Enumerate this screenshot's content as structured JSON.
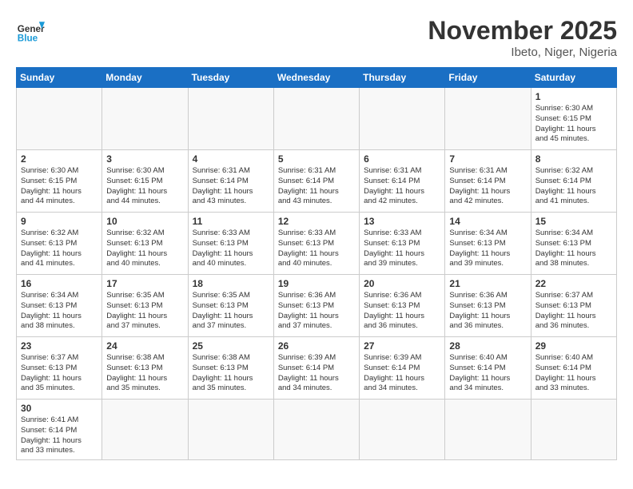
{
  "header": {
    "logo_general": "General",
    "logo_blue": "Blue",
    "month": "November 2025",
    "location": "Ibeto, Niger, Nigeria"
  },
  "days_of_week": [
    "Sunday",
    "Monday",
    "Tuesday",
    "Wednesday",
    "Thursday",
    "Friday",
    "Saturday"
  ],
  "weeks": [
    [
      {
        "day": "",
        "info": ""
      },
      {
        "day": "",
        "info": ""
      },
      {
        "day": "",
        "info": ""
      },
      {
        "day": "",
        "info": ""
      },
      {
        "day": "",
        "info": ""
      },
      {
        "day": "",
        "info": ""
      },
      {
        "day": "1",
        "info": "Sunrise: 6:30 AM\nSunset: 6:15 PM\nDaylight: 11 hours\nand 45 minutes."
      }
    ],
    [
      {
        "day": "2",
        "info": "Sunrise: 6:30 AM\nSunset: 6:15 PM\nDaylight: 11 hours\nand 44 minutes."
      },
      {
        "day": "3",
        "info": "Sunrise: 6:30 AM\nSunset: 6:15 PM\nDaylight: 11 hours\nand 44 minutes."
      },
      {
        "day": "4",
        "info": "Sunrise: 6:31 AM\nSunset: 6:14 PM\nDaylight: 11 hours\nand 43 minutes."
      },
      {
        "day": "5",
        "info": "Sunrise: 6:31 AM\nSunset: 6:14 PM\nDaylight: 11 hours\nand 43 minutes."
      },
      {
        "day": "6",
        "info": "Sunrise: 6:31 AM\nSunset: 6:14 PM\nDaylight: 11 hours\nand 42 minutes."
      },
      {
        "day": "7",
        "info": "Sunrise: 6:31 AM\nSunset: 6:14 PM\nDaylight: 11 hours\nand 42 minutes."
      },
      {
        "day": "8",
        "info": "Sunrise: 6:32 AM\nSunset: 6:14 PM\nDaylight: 11 hours\nand 41 minutes."
      }
    ],
    [
      {
        "day": "9",
        "info": "Sunrise: 6:32 AM\nSunset: 6:13 PM\nDaylight: 11 hours\nand 41 minutes."
      },
      {
        "day": "10",
        "info": "Sunrise: 6:32 AM\nSunset: 6:13 PM\nDaylight: 11 hours\nand 40 minutes."
      },
      {
        "day": "11",
        "info": "Sunrise: 6:33 AM\nSunset: 6:13 PM\nDaylight: 11 hours\nand 40 minutes."
      },
      {
        "day": "12",
        "info": "Sunrise: 6:33 AM\nSunset: 6:13 PM\nDaylight: 11 hours\nand 40 minutes."
      },
      {
        "day": "13",
        "info": "Sunrise: 6:33 AM\nSunset: 6:13 PM\nDaylight: 11 hours\nand 39 minutes."
      },
      {
        "day": "14",
        "info": "Sunrise: 6:34 AM\nSunset: 6:13 PM\nDaylight: 11 hours\nand 39 minutes."
      },
      {
        "day": "15",
        "info": "Sunrise: 6:34 AM\nSunset: 6:13 PM\nDaylight: 11 hours\nand 38 minutes."
      }
    ],
    [
      {
        "day": "16",
        "info": "Sunrise: 6:34 AM\nSunset: 6:13 PM\nDaylight: 11 hours\nand 38 minutes."
      },
      {
        "day": "17",
        "info": "Sunrise: 6:35 AM\nSunset: 6:13 PM\nDaylight: 11 hours\nand 37 minutes."
      },
      {
        "day": "18",
        "info": "Sunrise: 6:35 AM\nSunset: 6:13 PM\nDaylight: 11 hours\nand 37 minutes."
      },
      {
        "day": "19",
        "info": "Sunrise: 6:36 AM\nSunset: 6:13 PM\nDaylight: 11 hours\nand 37 minutes."
      },
      {
        "day": "20",
        "info": "Sunrise: 6:36 AM\nSunset: 6:13 PM\nDaylight: 11 hours\nand 36 minutes."
      },
      {
        "day": "21",
        "info": "Sunrise: 6:36 AM\nSunset: 6:13 PM\nDaylight: 11 hours\nand 36 minutes."
      },
      {
        "day": "22",
        "info": "Sunrise: 6:37 AM\nSunset: 6:13 PM\nDaylight: 11 hours\nand 36 minutes."
      }
    ],
    [
      {
        "day": "23",
        "info": "Sunrise: 6:37 AM\nSunset: 6:13 PM\nDaylight: 11 hours\nand 35 minutes."
      },
      {
        "day": "24",
        "info": "Sunrise: 6:38 AM\nSunset: 6:13 PM\nDaylight: 11 hours\nand 35 minutes."
      },
      {
        "day": "25",
        "info": "Sunrise: 6:38 AM\nSunset: 6:13 PM\nDaylight: 11 hours\nand 35 minutes."
      },
      {
        "day": "26",
        "info": "Sunrise: 6:39 AM\nSunset: 6:14 PM\nDaylight: 11 hours\nand 34 minutes."
      },
      {
        "day": "27",
        "info": "Sunrise: 6:39 AM\nSunset: 6:14 PM\nDaylight: 11 hours\nand 34 minutes."
      },
      {
        "day": "28",
        "info": "Sunrise: 6:40 AM\nSunset: 6:14 PM\nDaylight: 11 hours\nand 34 minutes."
      },
      {
        "day": "29",
        "info": "Sunrise: 6:40 AM\nSunset: 6:14 PM\nDaylight: 11 hours\nand 33 minutes."
      }
    ],
    [
      {
        "day": "30",
        "info": "Sunrise: 6:41 AM\nSunset: 6:14 PM\nDaylight: 11 hours\nand 33 minutes."
      },
      {
        "day": "",
        "info": ""
      },
      {
        "day": "",
        "info": ""
      },
      {
        "day": "",
        "info": ""
      },
      {
        "day": "",
        "info": ""
      },
      {
        "day": "",
        "info": ""
      },
      {
        "day": "",
        "info": ""
      }
    ]
  ]
}
